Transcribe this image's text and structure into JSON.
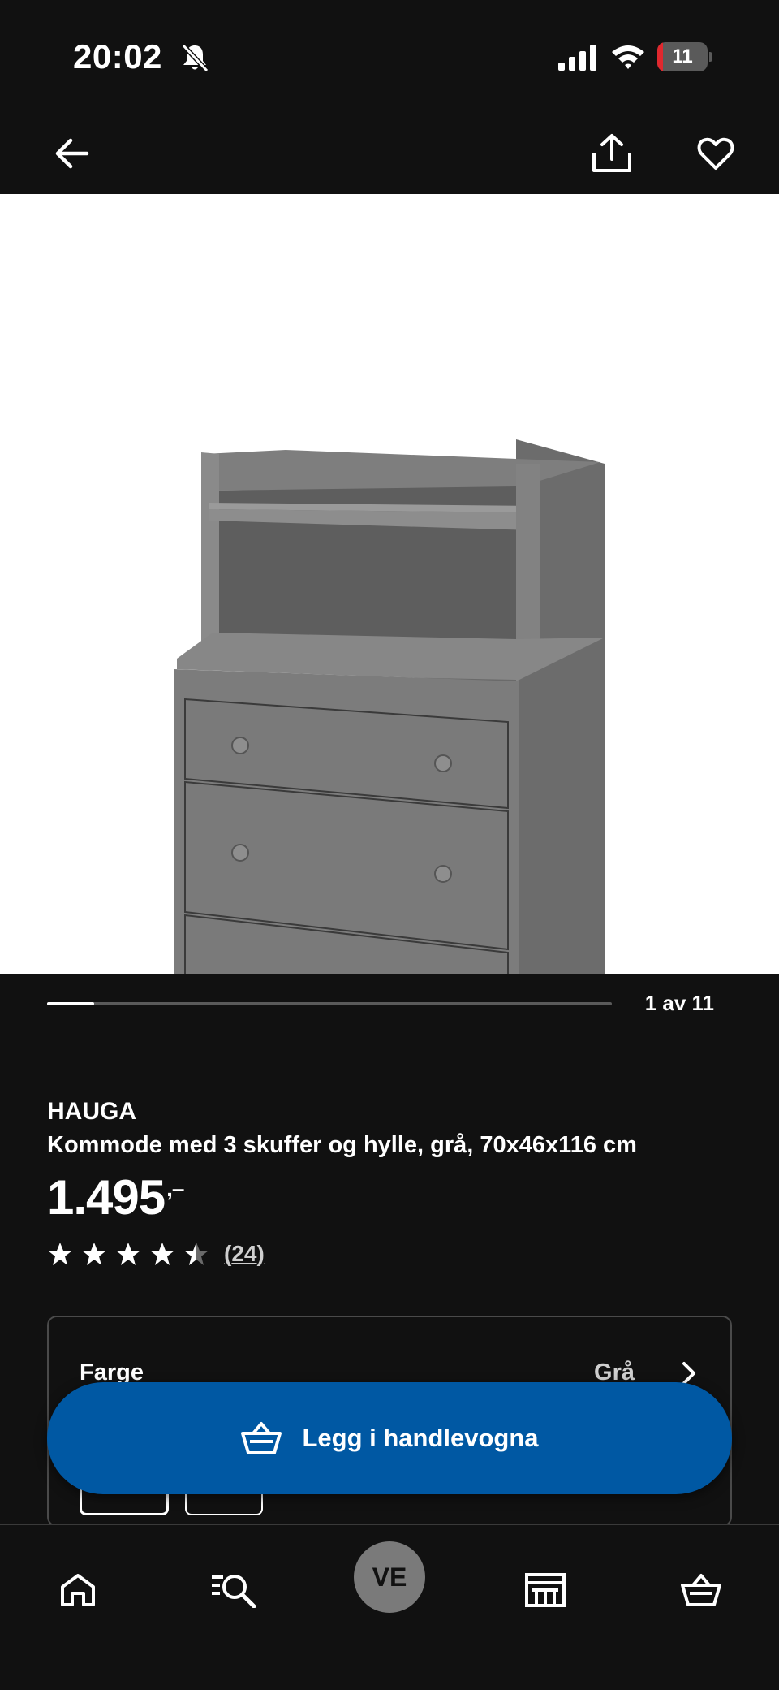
{
  "status_bar": {
    "time": "20:02",
    "battery_level": "11",
    "battery_fraction": 0.11,
    "battery_color": "#e0282e"
  },
  "nav": {
    "back_icon": "arrow-left-icon",
    "share_icon": "share-icon",
    "favorite_icon": "heart-icon"
  },
  "gallery": {
    "counter": "1 av 11",
    "current_index": 1,
    "total": 11
  },
  "product": {
    "brand": "HAUGA",
    "description": "Kommode med 3 skuffer og hylle, grå, 70x46x116 cm",
    "price": "1.495",
    "price_suffix": ",–",
    "rating_value": 4.5,
    "rating_max": 5,
    "review_count": "24",
    "review_open": "(",
    "review_close": ")"
  },
  "color_option": {
    "label": "Farge",
    "value": "Grå"
  },
  "cta": {
    "label": "Legg i handlevogna",
    "icon": "basket-icon",
    "color": "#0058a3"
  },
  "tab_bar": {
    "home_icon": "home-icon",
    "search_icon": "search-list-icon",
    "profile_initials": "VE",
    "stores_icon": "store-icon",
    "cart_icon": "basket-icon"
  }
}
